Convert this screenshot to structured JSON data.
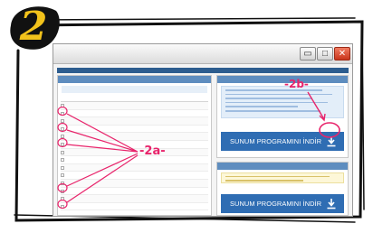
{
  "step": {
    "number": "2"
  },
  "window": {
    "controls": {
      "minimize": "▭",
      "maximize": "□",
      "close": "✕"
    }
  },
  "left_panel": {
    "rows": [
      {},
      {},
      {},
      {},
      {},
      {},
      {},
      {},
      {},
      {},
      {},
      {},
      {},
      {}
    ]
  },
  "right_panel": {
    "download_top": {
      "label": "SUNUM PROGRAMINI İNDİR"
    },
    "download_bottom": {
      "label": "SUNUM PROGRAMINI İNDİR"
    }
  },
  "annotations": {
    "label_2a": "-2a-",
    "label_2b": "-2b-"
  },
  "colors": {
    "accent_button": "#2f6db3",
    "annotation": "#e8246b",
    "badge": "#f2c21b"
  },
  "icons": [
    "download-arrow-icon",
    "minimize-icon",
    "maximize-icon",
    "close-icon"
  ]
}
